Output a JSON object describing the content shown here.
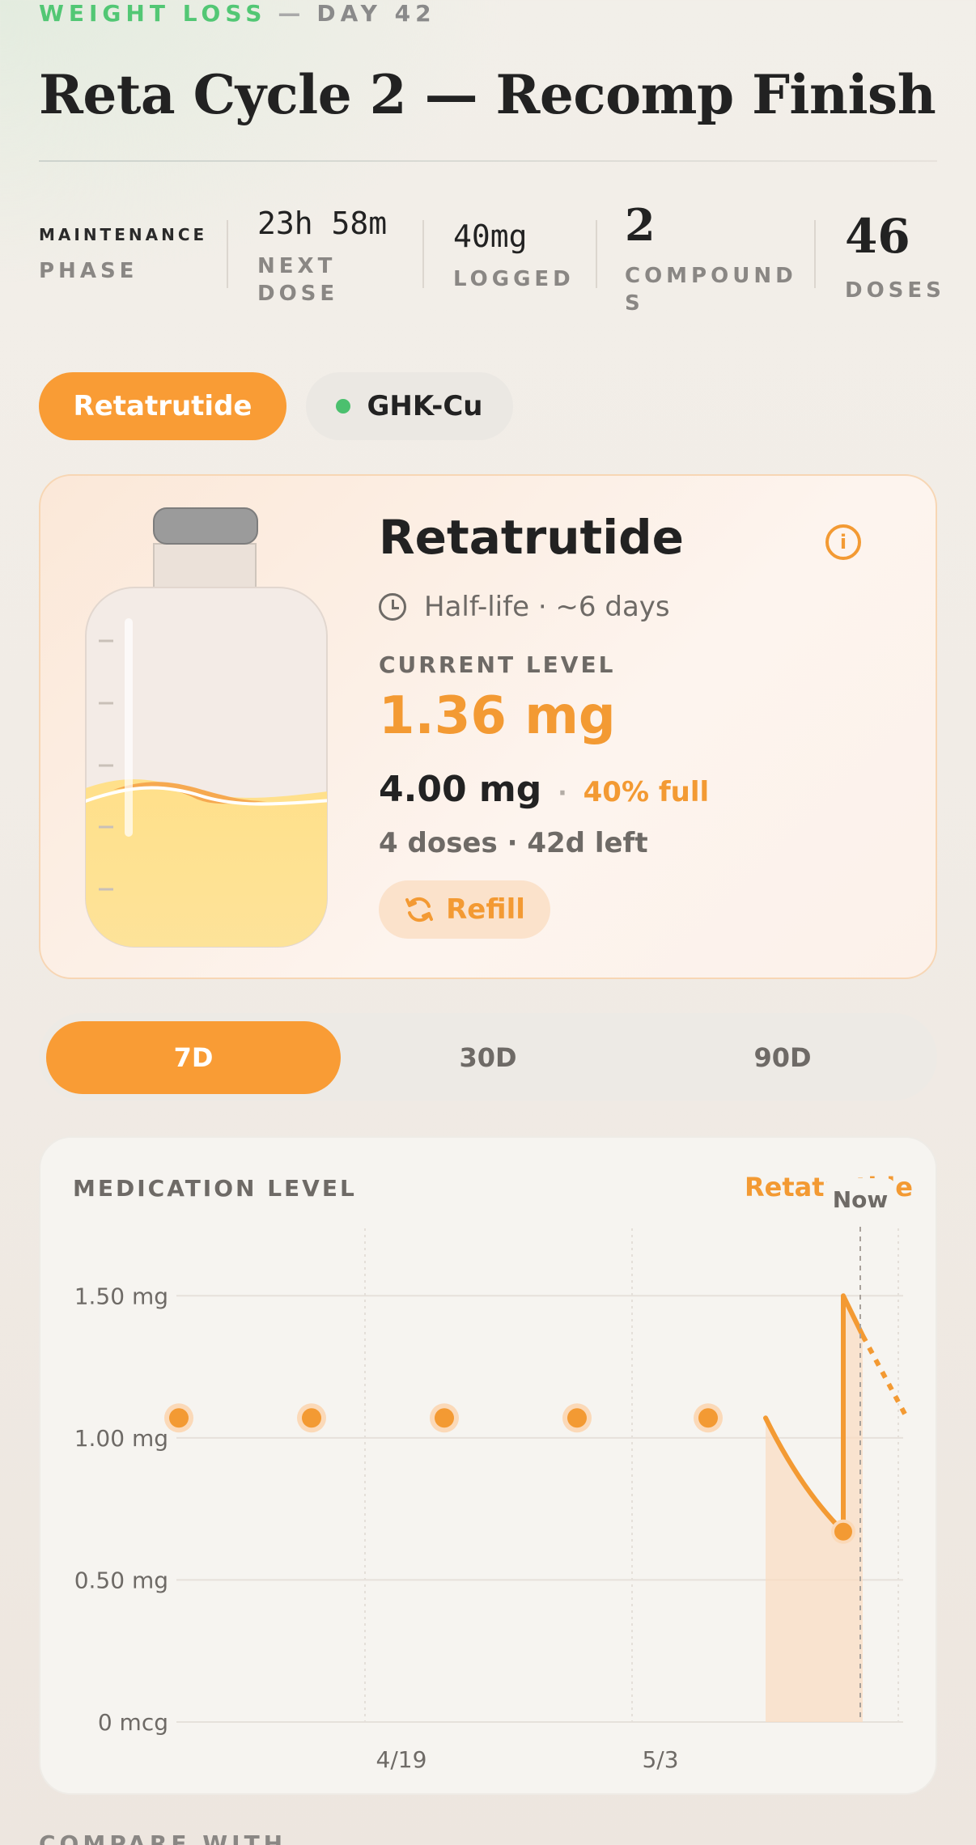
{
  "header": {
    "category": "WEIGHT LOSS",
    "separator": "—",
    "day": "DAY 42",
    "title": "Reta Cycle 2 — Recomp Finish"
  },
  "stats": {
    "phase_value": "MAINTENANCE",
    "phase_label": "PHASE",
    "next_dose_value": "23h 58m",
    "next_dose_label_1": "NEXT",
    "next_dose_label_2": "DOSE",
    "logged_value": "40mg",
    "logged_label": "LOGGED",
    "compounds_value": "2",
    "compounds_label_1": "COMPOUND",
    "compounds_label_2": "S",
    "doses_value": "46",
    "doses_label": "DOSES"
  },
  "compound_tabs": [
    {
      "label": "Retatrutide",
      "active": true
    },
    {
      "label": "GHK-Cu",
      "active": false
    }
  ],
  "vial_card": {
    "name": "Retatrutide",
    "half_life": "Half-life · ~6 days",
    "current_level_label": "CURRENT LEVEL",
    "current_level_value": "1.36 mg",
    "volume": "4.00 mg",
    "dot": "·",
    "fill_percent_text": "40% full",
    "fill_fraction": 0.4,
    "doses_left": "4 doses",
    "days_left": "· 42d left",
    "refill_label": "Refill"
  },
  "range_tabs": [
    {
      "label": "7D",
      "active": true
    },
    {
      "label": "30D",
      "active": false
    },
    {
      "label": "90D",
      "active": false
    }
  ],
  "chart": {
    "title": "MEDICATION LEVEL",
    "compound_label": "Retatrutide",
    "now_label": "Now"
  },
  "chart_data": {
    "type": "line",
    "title": "MEDICATION LEVEL",
    "series": [
      {
        "name": "Retatrutide"
      }
    ],
    "y_ticks": [
      "0 mcg",
      "0.50 mg",
      "1.00 mg",
      "1.50 mg"
    ],
    "x_ticks": [
      "4/19",
      "5/3"
    ],
    "ylim": [
      0,
      1.72
    ],
    "dose_markers_y": 1.07,
    "level_curve": [
      {
        "t": 0.0,
        "y": 1.07
      },
      {
        "t": 0.35,
        "y": 0.85
      },
      {
        "t": 1.0,
        "y": 0.67
      },
      {
        "t": 1.0,
        "y": 1.5
      },
      {
        "t": 1.25,
        "y": 1.36
      }
    ],
    "projection": [
      {
        "t": 1.25,
        "y": 1.36
      },
      {
        "t": 1.8,
        "y": 1.08
      }
    ],
    "now_value": 1.36,
    "grid": true,
    "colors": {
      "line": "#f39a33",
      "fill": "#fbdcc1"
    }
  },
  "footer": {
    "compare_label": "COMPARE WITH"
  },
  "colors": {
    "accent": "#f99c35",
    "green": "#52c774",
    "text_muted": "#6e6a66"
  }
}
